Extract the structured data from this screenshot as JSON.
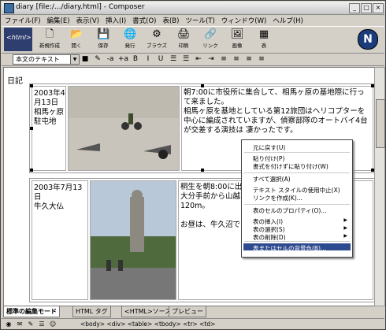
{
  "window": {
    "title": "diary [file:/.../diary.html] - Composer"
  },
  "menubar": [
    "ファイル(F)",
    "編集(E)",
    "表示(V)",
    "挿入(I)",
    "書式(O)",
    "表(B)",
    "ツール(T)",
    "ウィンドウ(W)",
    "ヘルプ(H)"
  ],
  "toolbar": {
    "badge": "<html>",
    "buttons": [
      {
        "label": "新規作成",
        "icon": "new-page-icon",
        "glyph": "🗋"
      },
      {
        "label": "開く",
        "icon": "open-icon",
        "glyph": "📂"
      },
      {
        "label": "保存",
        "icon": "save-icon",
        "glyph": "💾"
      },
      {
        "label": "発行",
        "icon": "publish-icon",
        "glyph": "🌐"
      },
      {
        "label": "ブラウズ",
        "icon": "browse-icon",
        "glyph": "⚙"
      },
      {
        "label": "印刷",
        "icon": "print-icon",
        "glyph": "🖨"
      },
      {
        "label": "リンク",
        "icon": "link-icon",
        "glyph": "🔗"
      },
      {
        "label": "画像",
        "icon": "image-icon",
        "glyph": "🖼"
      },
      {
        "label": "表",
        "icon": "table-icon",
        "glyph": "▦"
      }
    ],
    "logo": "N"
  },
  "format": {
    "paragraph_style": "本文のテキスト",
    "tools": [
      "■",
      "✎",
      "-a",
      "+a",
      "B",
      "I",
      "U",
      "☰",
      "☰",
      "⇤",
      "⇥",
      "≡",
      "≡",
      "≡",
      "≡"
    ]
  },
  "document": {
    "heading": "日記",
    "rows": [
      {
        "date": "2003年4月13日\n相馬ヶ原駐屯地",
        "text": "朝7:00に市役所に集合して、相馬ヶ原の基地際に行って来ました。\n相馬ヶ原を基地としている第12旅団はヘリコプターを中心に編成されていますが、偵察部隊のオートバイ4台が交差する演技は 凄かったです。"
      },
      {
        "date": "2003年7月13日\n牛久大仏",
        "text": "桐生を朝8:00に出\n大分手前から山越\n120m。\n\nお昼は、牛久沼で"
      }
    ]
  },
  "context_menu": {
    "items": [
      {
        "label": "元に戻す(U)",
        "submenu": false
      },
      {
        "label": "貼り付け(P)",
        "submenu": false
      },
      {
        "label": "書式を付けずに貼り付け(W)",
        "submenu": false
      },
      {
        "label": "すべて選択(A)",
        "submenu": false
      },
      {
        "label": "テキスト スタイルの使用中止(X)",
        "submenu": false
      },
      {
        "label": "リンクを作成(K)...",
        "submenu": false
      },
      {
        "label": "表のセルのプロパティ(O)...",
        "submenu": false
      },
      {
        "label": "表の挿入(I)",
        "submenu": true
      },
      {
        "label": "表の選択(S)",
        "submenu": true
      },
      {
        "label": "表の削除(D)",
        "submenu": true
      },
      {
        "label": "表またはセルの背景色(B)...",
        "submenu": false,
        "highlighted": true
      }
    ]
  },
  "edit_tabs": [
    {
      "label": "標準の編集モード",
      "active": true
    },
    {
      "label": "HTML タグ",
      "active": false
    },
    {
      "label": "<HTML>ソース",
      "active": false
    },
    {
      "label": "プレビュー",
      "active": false
    }
  ],
  "status": {
    "path": "<body> <div> <table> <tbody> <tr> <td>"
  },
  "colors": {
    "highlight": "#2f4b8f",
    "toolbar_bg": "#d4d0c8"
  }
}
